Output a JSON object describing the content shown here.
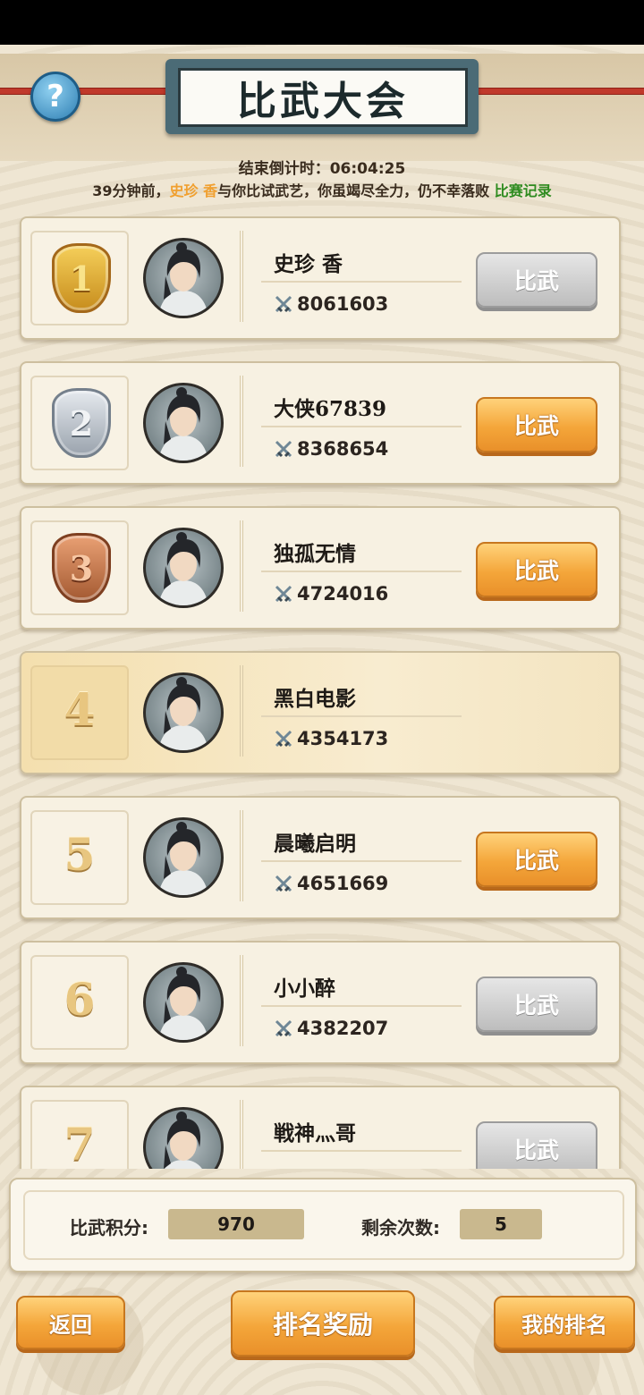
{
  "header": {
    "title": "比武大会",
    "help_label": "?",
    "countdown_label": "结束倒计时：",
    "countdown_value": "06:04:25"
  },
  "notice": {
    "prefix": "39分钟前，",
    "opponent": "史珍 香",
    "message": "与你比试武艺，你虽竭尽全力，仍不幸落败 ",
    "record_link": "比赛记录"
  },
  "rankings": [
    {
      "rank": "1",
      "name": "史珍 香",
      "power": "8061603",
      "button": "比武",
      "button_state": "disabled"
    },
    {
      "rank": "2",
      "name": "大侠67839",
      "power": "8368654",
      "button": "比武",
      "button_state": "active"
    },
    {
      "rank": "3",
      "name": "独孤无情",
      "power": "4724016",
      "button": "比武",
      "button_state": "active"
    },
    {
      "rank": "4",
      "name": "黑白电影",
      "power": "4354173",
      "button": "",
      "button_state": "none"
    },
    {
      "rank": "5",
      "name": "晨曦启明",
      "power": "4651669",
      "button": "比武",
      "button_state": "active"
    },
    {
      "rank": "6",
      "name": "小小醉",
      "power": "4382207",
      "button": "比武",
      "button_state": "disabled"
    },
    {
      "rank": "7",
      "name": "戦神灬哥",
      "power": "",
      "button": "比武",
      "button_state": "disabled"
    }
  ],
  "stats": {
    "points_label": "比武积分:",
    "points_value": "970",
    "remaining_label": "剩余次数:",
    "remaining_value": "5"
  },
  "buttons": {
    "back": "返回",
    "rewards": "排名奖励",
    "my_rank": "我的排名"
  },
  "colors": {
    "accent_orange": "#f4a63a",
    "disabled_gray": "#bdbdbd",
    "opponent_name": "#f0a030",
    "record_link": "#2e8b1f"
  }
}
